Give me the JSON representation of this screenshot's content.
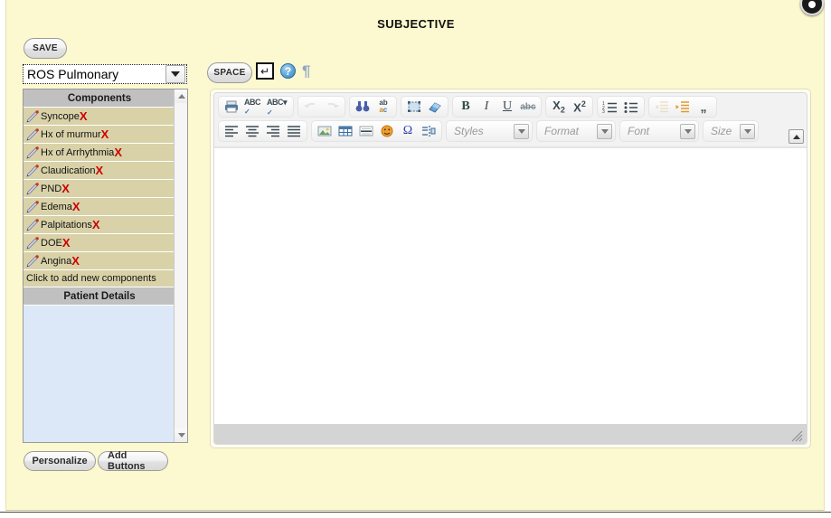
{
  "page": {
    "title": "SUBJECTIVE"
  },
  "toolbar_top": {
    "save_label": "SAVE",
    "space_label": "SPACE",
    "enter_icon": "↵",
    "help_icon": "?",
    "pilcrow_icon": "¶"
  },
  "template_select": {
    "value": "ROS Pulmonary",
    "dropdown_icon": "chevron-down-icon"
  },
  "components_panel": {
    "header": "Components",
    "items": [
      {
        "label": "Syncope",
        "remove_icon": "X",
        "edit_icon": "pencil-icon"
      },
      {
        "label": "Hx of murmur",
        "remove_icon": "X",
        "edit_icon": "pencil-icon"
      },
      {
        "label": "Hx of Arrhythmia",
        "remove_icon": "X",
        "edit_icon": "pencil-icon"
      },
      {
        "label": "Claudication",
        "remove_icon": "X",
        "edit_icon": "pencil-icon"
      },
      {
        "label": "PND",
        "remove_icon": "X",
        "edit_icon": "pencil-icon"
      },
      {
        "label": "Edema",
        "remove_icon": "X",
        "edit_icon": "pencil-icon"
      },
      {
        "label": "Palpitations",
        "remove_icon": "X",
        "edit_icon": "pencil-icon"
      },
      {
        "label": "DOE",
        "remove_icon": "X",
        "edit_icon": "pencil-icon"
      },
      {
        "label": "Angina",
        "remove_icon": "X",
        "edit_icon": "pencil-icon"
      }
    ],
    "add_new_label": "Click to add new components",
    "patient_details_header": "Patient Details"
  },
  "footer_buttons": {
    "personalize_label": "Personalize",
    "add_buttons_label": "Add Buttons"
  },
  "editor": {
    "content": "",
    "row1_groups": [
      {
        "name": "document",
        "buttons": [
          {
            "name": "print-icon",
            "glyph": "printer"
          },
          {
            "name": "spellcheck-icon",
            "glyph": "abc-check"
          },
          {
            "name": "spellcheck-menu-icon",
            "glyph": "abc-check-arrow"
          }
        ]
      },
      {
        "name": "history",
        "buttons": [
          {
            "name": "undo-icon",
            "glyph": "undo"
          },
          {
            "name": "redo-icon",
            "glyph": "redo"
          }
        ]
      },
      {
        "name": "find",
        "buttons": [
          {
            "name": "find-icon",
            "glyph": "binoculars"
          },
          {
            "name": "replace-icon",
            "glyph": "ab-ac"
          }
        ]
      },
      {
        "name": "selection",
        "buttons": [
          {
            "name": "select-all-icon",
            "glyph": "select-all"
          },
          {
            "name": "remove-format-icon",
            "glyph": "eraser"
          }
        ]
      },
      {
        "name": "basic-styles",
        "buttons": [
          {
            "name": "bold-icon",
            "glyph": "B"
          },
          {
            "name": "italic-icon",
            "glyph": "I"
          },
          {
            "name": "underline-icon",
            "glyph": "U"
          },
          {
            "name": "strikethrough-icon",
            "glyph": "abc"
          }
        ]
      },
      {
        "name": "scripts",
        "buttons": [
          {
            "name": "subscript-icon",
            "glyph": "X2sub"
          },
          {
            "name": "superscript-icon",
            "glyph": "X2sup"
          }
        ]
      },
      {
        "name": "lists",
        "buttons": [
          {
            "name": "numbered-list-icon",
            "glyph": "ol"
          },
          {
            "name": "bulleted-list-icon",
            "glyph": "ul"
          }
        ]
      },
      {
        "name": "indent-quote",
        "buttons": [
          {
            "name": "outdent-icon",
            "glyph": "outdent"
          },
          {
            "name": "indent-icon",
            "glyph": "indent"
          },
          {
            "name": "blockquote-icon",
            "glyph": "quote"
          }
        ]
      }
    ],
    "row2_groups": [
      {
        "name": "alignment",
        "buttons": [
          {
            "name": "align-left-icon",
            "glyph": "align-left"
          },
          {
            "name": "align-center-icon",
            "glyph": "align-center"
          },
          {
            "name": "align-right-icon",
            "glyph": "align-right"
          },
          {
            "name": "align-justify-icon",
            "glyph": "align-justify"
          }
        ]
      },
      {
        "name": "insert",
        "buttons": [
          {
            "name": "image-icon",
            "glyph": "image"
          },
          {
            "name": "table-icon",
            "glyph": "table"
          },
          {
            "name": "horizontal-rule-icon",
            "glyph": "hr"
          },
          {
            "name": "smiley-icon",
            "glyph": "smiley"
          },
          {
            "name": "special-char-icon",
            "glyph": "omega"
          },
          {
            "name": "page-break-icon",
            "glyph": "pagebreak"
          }
        ]
      }
    ],
    "combos": [
      {
        "name": "styles-combo",
        "label": "Styles"
      },
      {
        "name": "format-combo",
        "label": "Format"
      },
      {
        "name": "font-combo",
        "label": "Font"
      },
      {
        "name": "size-combo",
        "label": "Size"
      }
    ],
    "collapse_icon": "collapse-toolbar-icon",
    "resize_grip_icon": "resize-grip-icon"
  }
}
